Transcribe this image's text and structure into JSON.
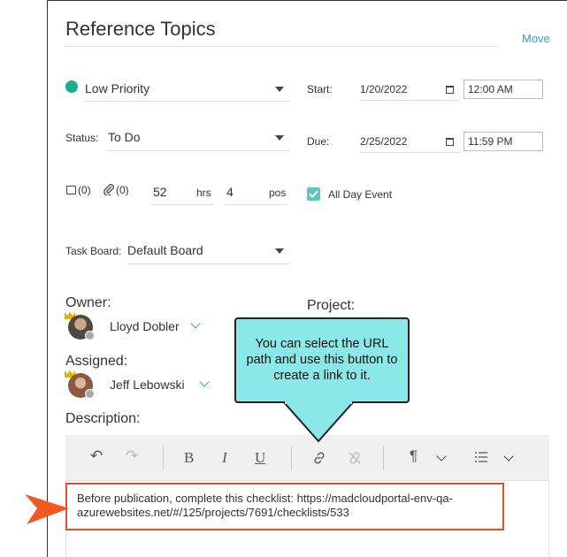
{
  "header": {
    "title": "Reference Topics",
    "move_link": "Move"
  },
  "priority": {
    "value": "Low Priority",
    "color": "#1fae8d"
  },
  "status": {
    "label": "Status:",
    "value": "To Do"
  },
  "start": {
    "label": "Start:",
    "date": "1/20/2022",
    "time": "12:00 AM"
  },
  "due": {
    "label": "Due:",
    "date": "2/25/2022",
    "time": "11:59 PM"
  },
  "counters": {
    "comments": "(0)",
    "attachments": "(0)",
    "hours_value": "52",
    "hours_unit": "hrs",
    "pos_value": "4",
    "pos_unit": "pos"
  },
  "all_day": {
    "label": "All Day Event",
    "checked": true
  },
  "task_board": {
    "label": "Task Board:",
    "value": "Default Board"
  },
  "owner": {
    "label": "Owner:",
    "name": "Lloyd Dobler"
  },
  "project": {
    "label": "Project:"
  },
  "assigned": {
    "label": "Assigned:",
    "name": "Jeff Lebowski"
  },
  "description": {
    "label": "Description:",
    "text": "Before publication, complete this checklist: https://madcloudportal-env-qa-azurewebsites.net/#/125/projects/7691/checklists/533"
  },
  "toolbar": {
    "undo": "↶",
    "redo": "↷",
    "bold": "B",
    "italic": "I",
    "underline": "U",
    "link": "link-icon",
    "unlink": "unlink-icon",
    "paragraph": "¶",
    "list": "list-icon"
  },
  "callout": {
    "text": "You can select the URL path and use this button to create a link to it."
  },
  "colors": {
    "accent": "#2a9fd8",
    "callout": "#8ae8e8",
    "highlight": "#e0522b",
    "arrow": "#f05a22"
  }
}
